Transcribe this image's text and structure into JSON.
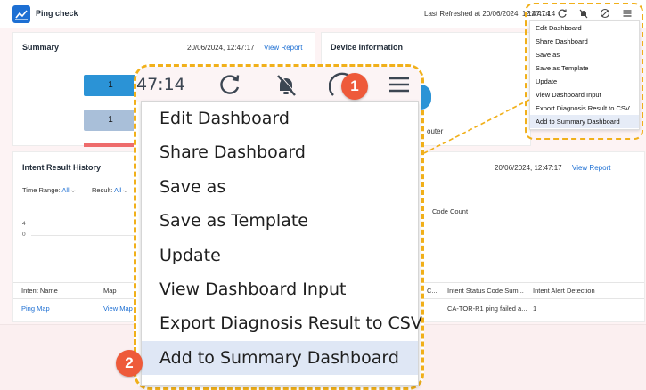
{
  "header": {
    "title": "Ping check",
    "refreshed": "Last Refreshed at 20/06/2024, 12:47:14"
  },
  "summary": {
    "title": "Summary",
    "time": "20/06/2024, 12:47:17",
    "link": "View Report",
    "blocks": [
      {
        "value": "1",
        "color": "#2b93d6"
      },
      {
        "value": "1",
        "color": "#a9bfd9"
      }
    ]
  },
  "device": {
    "title": "Device Information",
    "partial_label": "outer"
  },
  "history": {
    "title": "Intent Result History",
    "time": "20/06/2024, 12:47:17",
    "link": "View Report",
    "time_range_label": "Time Range:",
    "time_range_value": "All",
    "result_label": "Result:",
    "result_value": "All",
    "axis": [
      "4",
      "0"
    ],
    "partial_header": "Code Count",
    "columns": [
      "Intent Name",
      "Map",
      "C...",
      "Intent Status Code Sum...",
      "Intent Alert Detection"
    ],
    "rows": [
      {
        "name": "Ping Map",
        "map": "View Map",
        "status": "CA-TOR-R1 ping failed a...",
        "alert": "1"
      }
    ]
  },
  "zoom": {
    "time": "47:14"
  },
  "menu": {
    "items": [
      "Edit Dashboard",
      "Share Dashboard",
      "Save as",
      "Save as Template",
      "Update",
      "View Dashboard Input",
      "Export Diagnosis Result to CSV",
      "Add to Summary Dashboard"
    ],
    "selected_index": 7
  },
  "steps": {
    "one": "1",
    "two": "2"
  },
  "colors": {
    "accent": "#1d6fd3",
    "highlight": "#f1b01a",
    "badge": "#ee5a3a"
  }
}
